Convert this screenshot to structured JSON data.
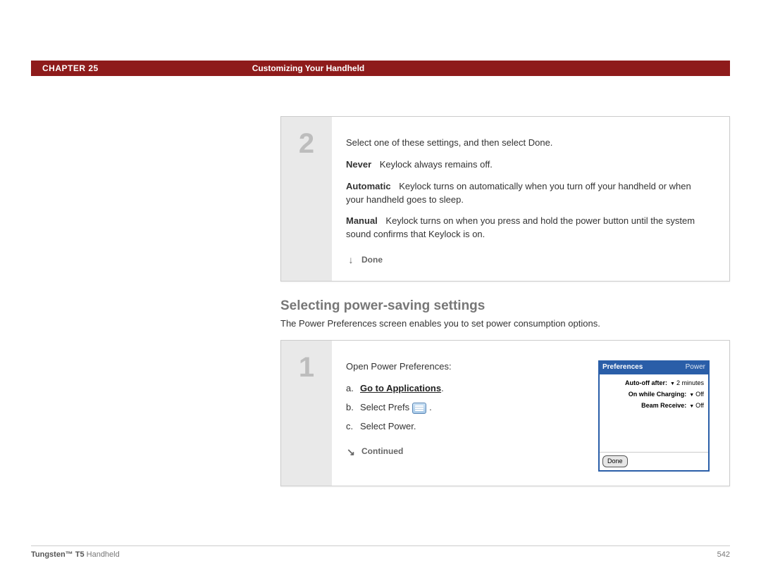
{
  "header": {
    "chapter_label": "CHAPTER 25",
    "chapter_title": "Customizing Your Handheld"
  },
  "step2": {
    "num": "2",
    "intro": "Select one of these settings, and then select Done.",
    "options": [
      {
        "label": "Never",
        "desc": "Keylock always remains off."
      },
      {
        "label": "Automatic",
        "desc": "Keylock turns on automatically when you turn off your handheld or when your handheld goes to sleep."
      },
      {
        "label": "Manual",
        "desc": "Keylock turns on when you press and hold the power button until the system sound confirms that Keylock is on."
      }
    ],
    "done_label": "Done"
  },
  "section": {
    "heading": "Selecting power-saving settings",
    "sub": "The Power Preferences screen enables you to set power consumption options."
  },
  "step1": {
    "num": "1",
    "intro": "Open Power Preferences:",
    "items": {
      "a_prefix": "a.",
      "a_link": "Go to Applications",
      "a_suffix": ".",
      "b_prefix": "b.",
      "b_before": "Select Prefs",
      "b_after": ".",
      "c_prefix": "c.",
      "c_text": "Select Power."
    },
    "continued_label": "Continued"
  },
  "palm": {
    "title_left": "Preferences",
    "title_right": "Power",
    "rows": [
      {
        "k": "Auto-off after:",
        "v": "2 minutes"
      },
      {
        "k": "On while Charging:",
        "v": "Off"
      },
      {
        "k": "Beam Receive:",
        "v": "Off"
      }
    ],
    "done": "Done"
  },
  "footer": {
    "product_bold": "Tungsten™ T5",
    "product_rest": " Handheld",
    "page": "542"
  }
}
